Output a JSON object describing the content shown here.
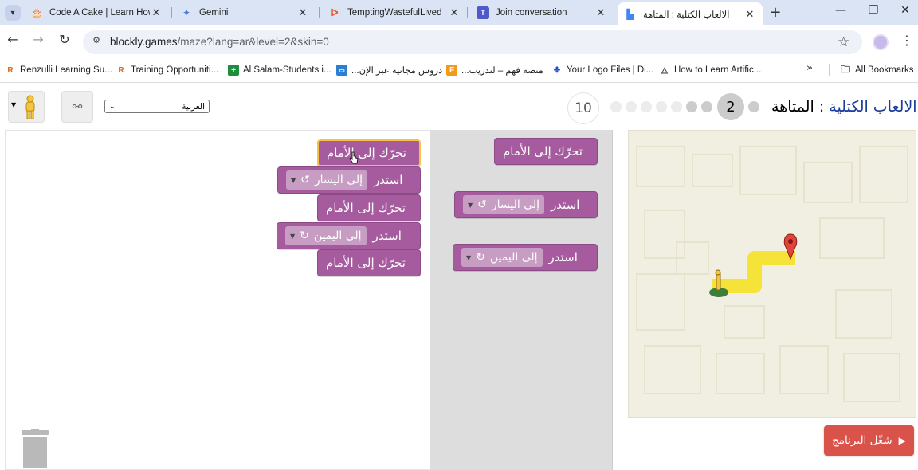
{
  "browser": {
    "tabs": [
      {
        "title": "Code A Cake | Learn How",
        "icon": "cake-icon"
      },
      {
        "title": "Gemini",
        "icon": "gemini-icon"
      },
      {
        "title": "TemptingWastefulLived",
        "icon": "stream-icon"
      },
      {
        "title": "Join conversation",
        "icon": "teams-icon"
      },
      {
        "title": "الالعاب الكتلية : المتاهة",
        "icon": "blockly-icon",
        "active": true
      }
    ],
    "new_tab": "+",
    "window_controls": {
      "minimize": "—",
      "maximize": "❐",
      "close": "✕"
    },
    "url_host": "blockly.games",
    "url_path": "/maze?lang=ar&level=2&skin=0",
    "bookmarks": [
      {
        "label": "Renzulli Learning Su...",
        "icon": "renzulli-icon"
      },
      {
        "label": "Training Opportuniti...",
        "icon": "renzulli-icon"
      },
      {
        "label": "Al Salam-Students i...",
        "icon": "sheets-icon"
      },
      {
        "label": "دروس مجانية عبر الإن...",
        "icon": "course-icon"
      },
      {
        "label": "منصة فهم – لتدريب...",
        "icon": "fahm-icon"
      },
      {
        "label": "Your Logo Files | Di...",
        "icon": "logo-files-icon"
      },
      {
        "label": "How to Learn Artific...",
        "icon": "ai-icon"
      }
    ],
    "bookmarks_more": "»",
    "all_bookmarks": "All Bookmarks"
  },
  "game": {
    "title_link": "الالعاب الكتلية",
    "title_rest": " : المتاهة",
    "current_level": "2",
    "max_level": "10",
    "language": "العربية",
    "run_label": "شغّل البرنامج",
    "toolbox": [
      {
        "label": "تحرّك إلى الأمام"
      },
      {
        "label": "استدر",
        "dropdown": "إلى اليسار",
        "turn": "↺"
      },
      {
        "label": "استدر",
        "dropdown": "إلى اليمين",
        "turn": "↻"
      }
    ],
    "workspace": [
      {
        "label": "تحرّك إلى الأمام"
      },
      {
        "label": "استدر",
        "dropdown": "إلى اليسار",
        "turn": "↺"
      },
      {
        "label": "تحرّك إلى الأمام"
      },
      {
        "label": "استدر",
        "dropdown": "إلى اليمين",
        "turn": "↻"
      },
      {
        "label": "تحرّك إلى الأمام"
      }
    ]
  },
  "colors": {
    "block": "#a55b9e",
    "block_selected_outline": "#f7c244",
    "run_button": "#d9534b",
    "path": "#f5e33a",
    "title_link": "#1a3c9c"
  }
}
